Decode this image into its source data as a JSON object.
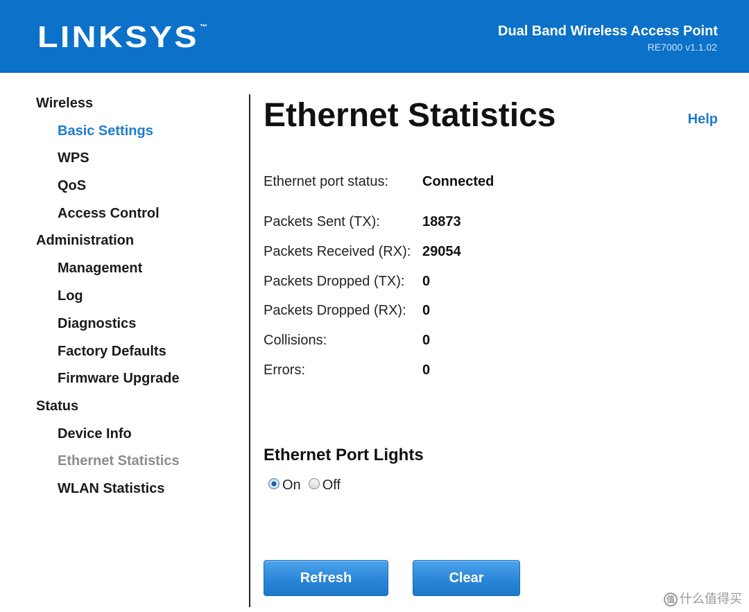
{
  "header": {
    "logo_text": "LINKSYS",
    "logo_tm": "™",
    "product_name": "Dual Band Wireless Access Point",
    "model_version": "RE7000 v1.1.02"
  },
  "sidebar": {
    "sections": [
      {
        "label": "Wireless",
        "items": [
          {
            "label": "Basic Settings"
          },
          {
            "label": "WPS"
          },
          {
            "label": "QoS"
          },
          {
            "label": "Access Control"
          }
        ]
      },
      {
        "label": "Administration",
        "items": [
          {
            "label": "Management"
          },
          {
            "label": "Log"
          },
          {
            "label": "Diagnostics"
          },
          {
            "label": "Factory Defaults"
          },
          {
            "label": "Firmware Upgrade"
          }
        ]
      },
      {
        "label": "Status",
        "items": [
          {
            "label": "Device Info"
          },
          {
            "label": "Ethernet Statistics"
          },
          {
            "label": "WLAN Statistics"
          }
        ]
      }
    ]
  },
  "main": {
    "title": "Ethernet Statistics",
    "help_label": "Help",
    "stats": [
      {
        "label": "Ethernet port status:",
        "value": "Connected"
      },
      {
        "label": "Packets Sent (TX):",
        "value": "18873"
      },
      {
        "label": "Packets Received (RX):",
        "value": "29054"
      },
      {
        "label": "Packets Dropped (TX):",
        "value": "0"
      },
      {
        "label": "Packets Dropped (RX):",
        "value": "0"
      },
      {
        "label": "Collisions:",
        "value": "0"
      },
      {
        "label": "Errors:",
        "value": "0"
      }
    ],
    "port_lights": {
      "title": "Ethernet Port Lights",
      "on_label": "On",
      "off_label": "Off",
      "selected": "On"
    },
    "buttons": {
      "refresh_label": "Refresh",
      "clear_label": "Clear"
    }
  },
  "watermark": {
    "badge": "值",
    "text": "什么值得买"
  },
  "colors": {
    "header_blue": "#0b71c9",
    "link_blue": "#1e7ccc",
    "current_gray": "#8c8c8c",
    "button_blue": "#2a86d8"
  }
}
